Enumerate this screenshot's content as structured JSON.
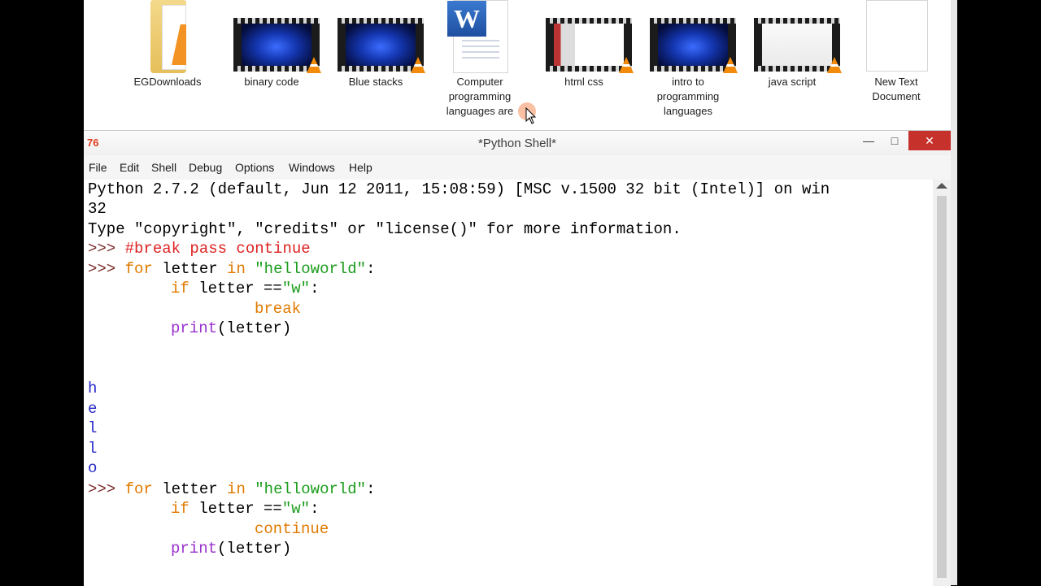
{
  "desktop": {
    "icons": [
      {
        "label": "EGDownloads"
      },
      {
        "label": "binary code"
      },
      {
        "label": "Blue stacks"
      },
      {
        "label": "Computer programming languages are used to to com..."
      },
      {
        "label": "html css"
      },
      {
        "label": "intro to programming languages"
      },
      {
        "label": "java script"
      },
      {
        "label": "New Text Document"
      }
    ],
    "word_badge": "W"
  },
  "window": {
    "title": "*Python Shell*",
    "logo": "76",
    "min_glyph": "—",
    "max_glyph": "□",
    "close_glyph": "✕"
  },
  "menu": {
    "file": "File",
    "edit": "Edit",
    "shell": "Shell",
    "debug": "Debug",
    "options": "Options",
    "windows": "Windows",
    "help": "Help"
  },
  "shell": {
    "banner_line1": "Python 2.7.2 (default, Jun 12 2011, 15:08:59) [MSC v.1500 32 bit (Intel)] on win",
    "banner_line2": "32",
    "info_line": "Type \"copyright\", \"credits\" or \"license()\" for more information.",
    "prompt": ">>> ",
    "comment": "#break pass continue",
    "kw_for": "for",
    "kw_in": "in",
    "kw_if": "if",
    "kw_break": "break",
    "kw_continue": "continue",
    "var_letter": " letter ",
    "str_helloworld": "\"helloworld\"",
    "colon": ":",
    "cond_letter": " letter ==",
    "str_w": "\"w\"",
    "fn_print": "print",
    "print_args": "(letter)",
    "output": [
      "h",
      "e",
      "l",
      "l",
      "o"
    ]
  },
  "colors": {
    "keyword": "#e07a00",
    "string": "#1a9c1a",
    "comment": "#d22222",
    "builtin": "#9932cc",
    "output": "#2828c8",
    "close_button": "#c7312b"
  }
}
